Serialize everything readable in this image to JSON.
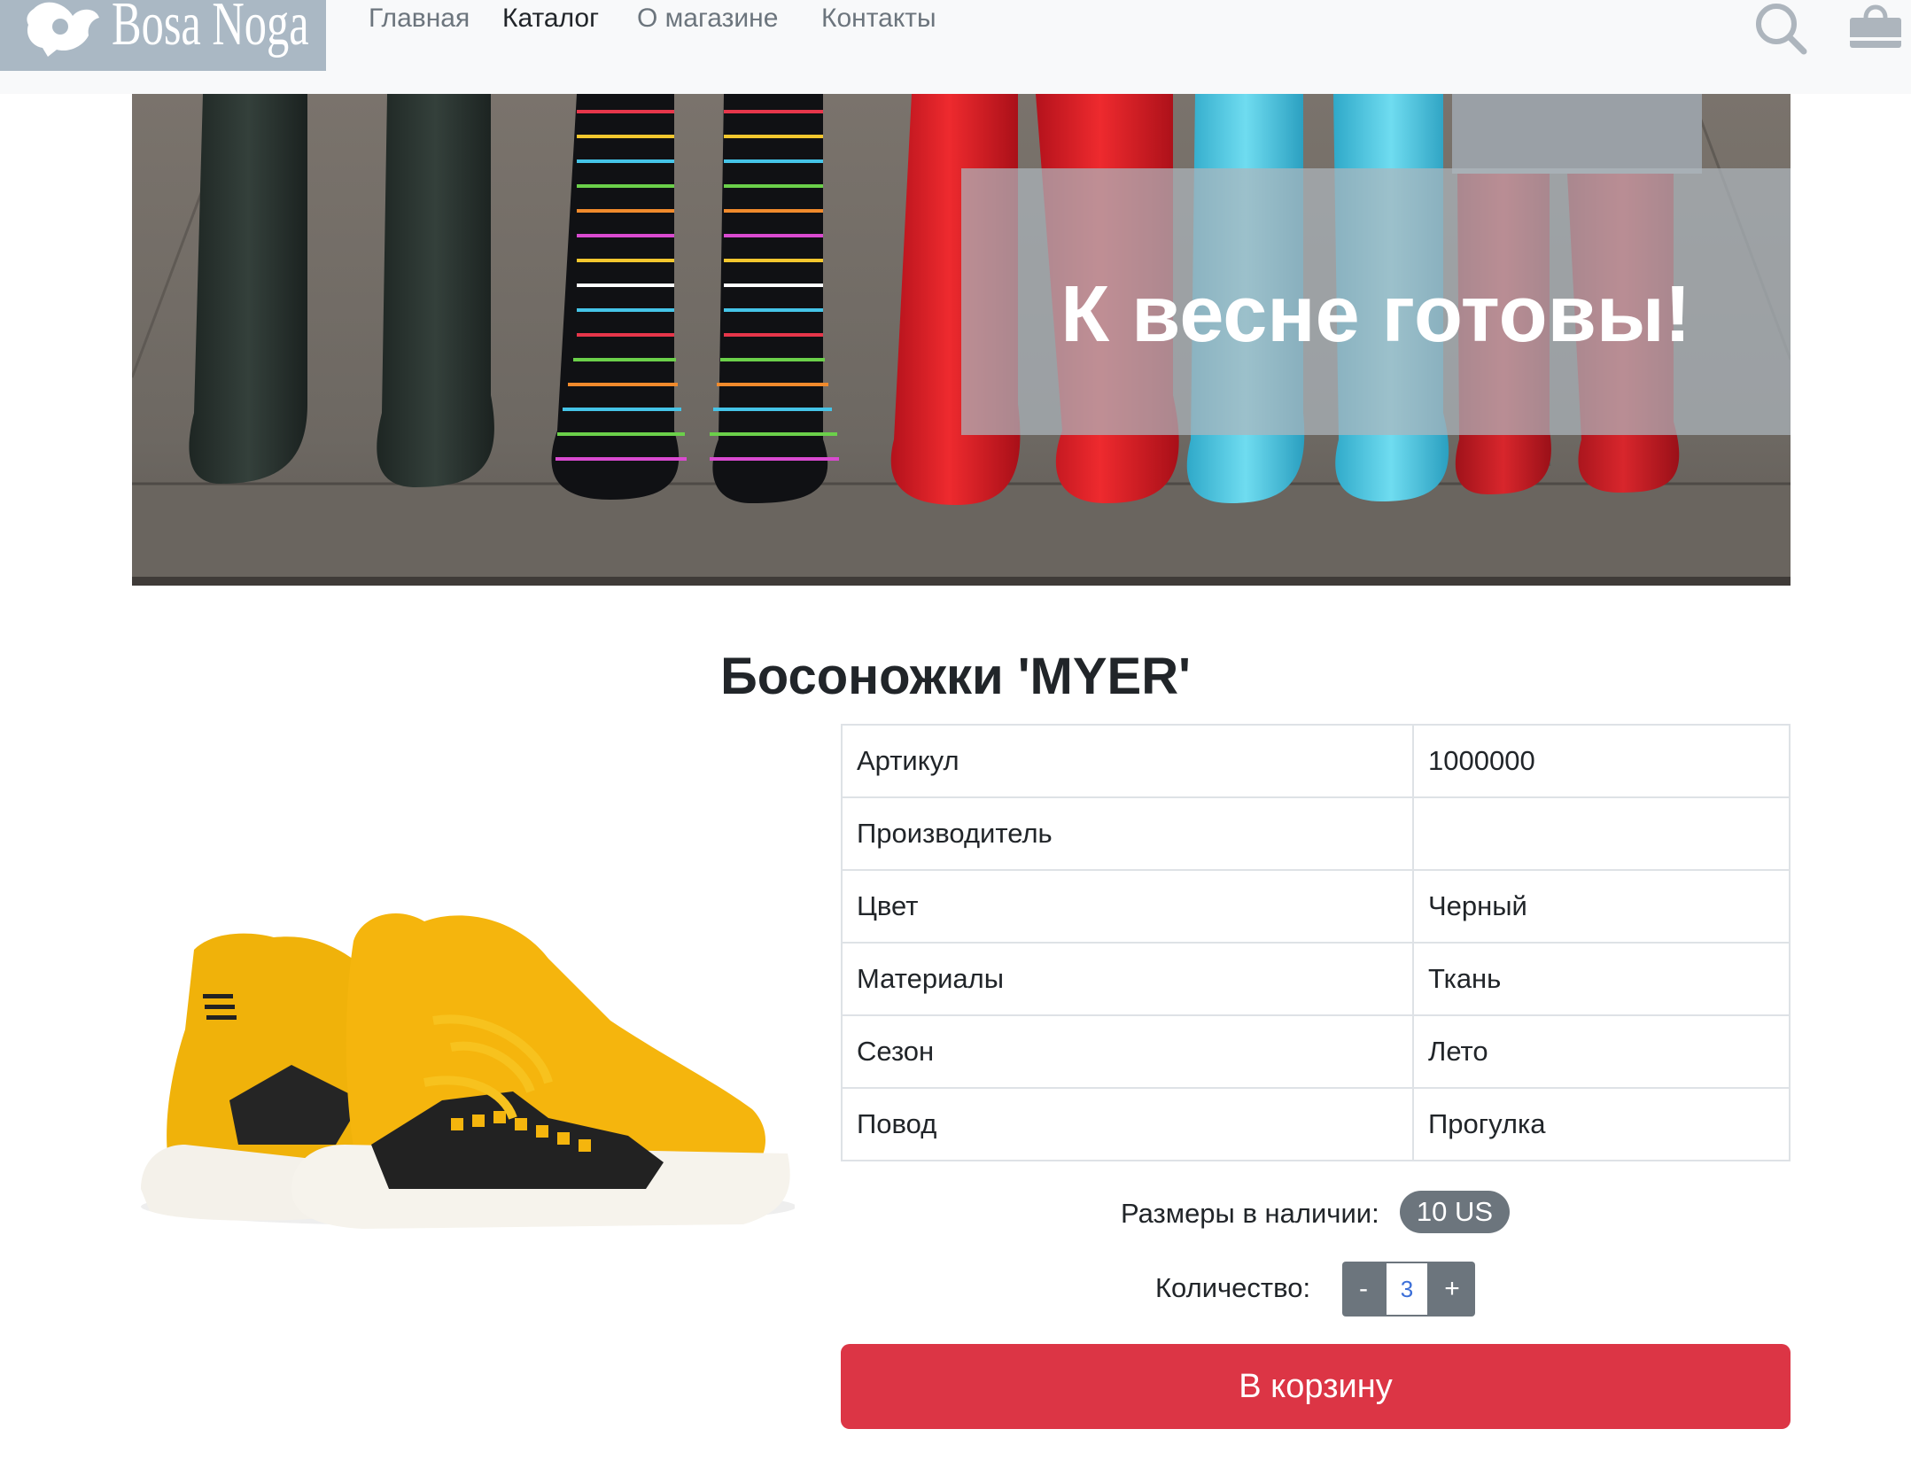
{
  "brand": {
    "name": "Bosa Noga"
  },
  "nav": {
    "items": [
      {
        "label": "Главная",
        "active": false
      },
      {
        "label": "Каталог",
        "active": true
      },
      {
        "label": "О магазине",
        "active": false
      },
      {
        "label": "Контакты",
        "active": false
      }
    ],
    "icons": [
      "search-icon",
      "cart-icon"
    ]
  },
  "banner": {
    "title": "К весне готовы!"
  },
  "product": {
    "title": "Босоножки 'MYER'",
    "specs": [
      {
        "key": "Артикул",
        "value": "1000000"
      },
      {
        "key": "Производитель",
        "value": ""
      },
      {
        "key": "Цвет",
        "value": "Черный"
      },
      {
        "key": "Материалы",
        "value": "Ткань"
      },
      {
        "key": "Сезон",
        "value": "Лето"
      },
      {
        "key": "Повод",
        "value": "Прогулка"
      }
    ],
    "sizes_label": "Размеры в наличии:",
    "sizes": [
      "10 US"
    ],
    "quantity_label": "Количество:",
    "quantity": "3",
    "minus_label": "-",
    "plus_label": "+",
    "add_to_cart_label": "В корзину"
  },
  "colors": {
    "primary_button": "#dc3545",
    "secondary": "#6c757d",
    "navbar_bg": "#f8f9fa",
    "text": "#212529"
  }
}
